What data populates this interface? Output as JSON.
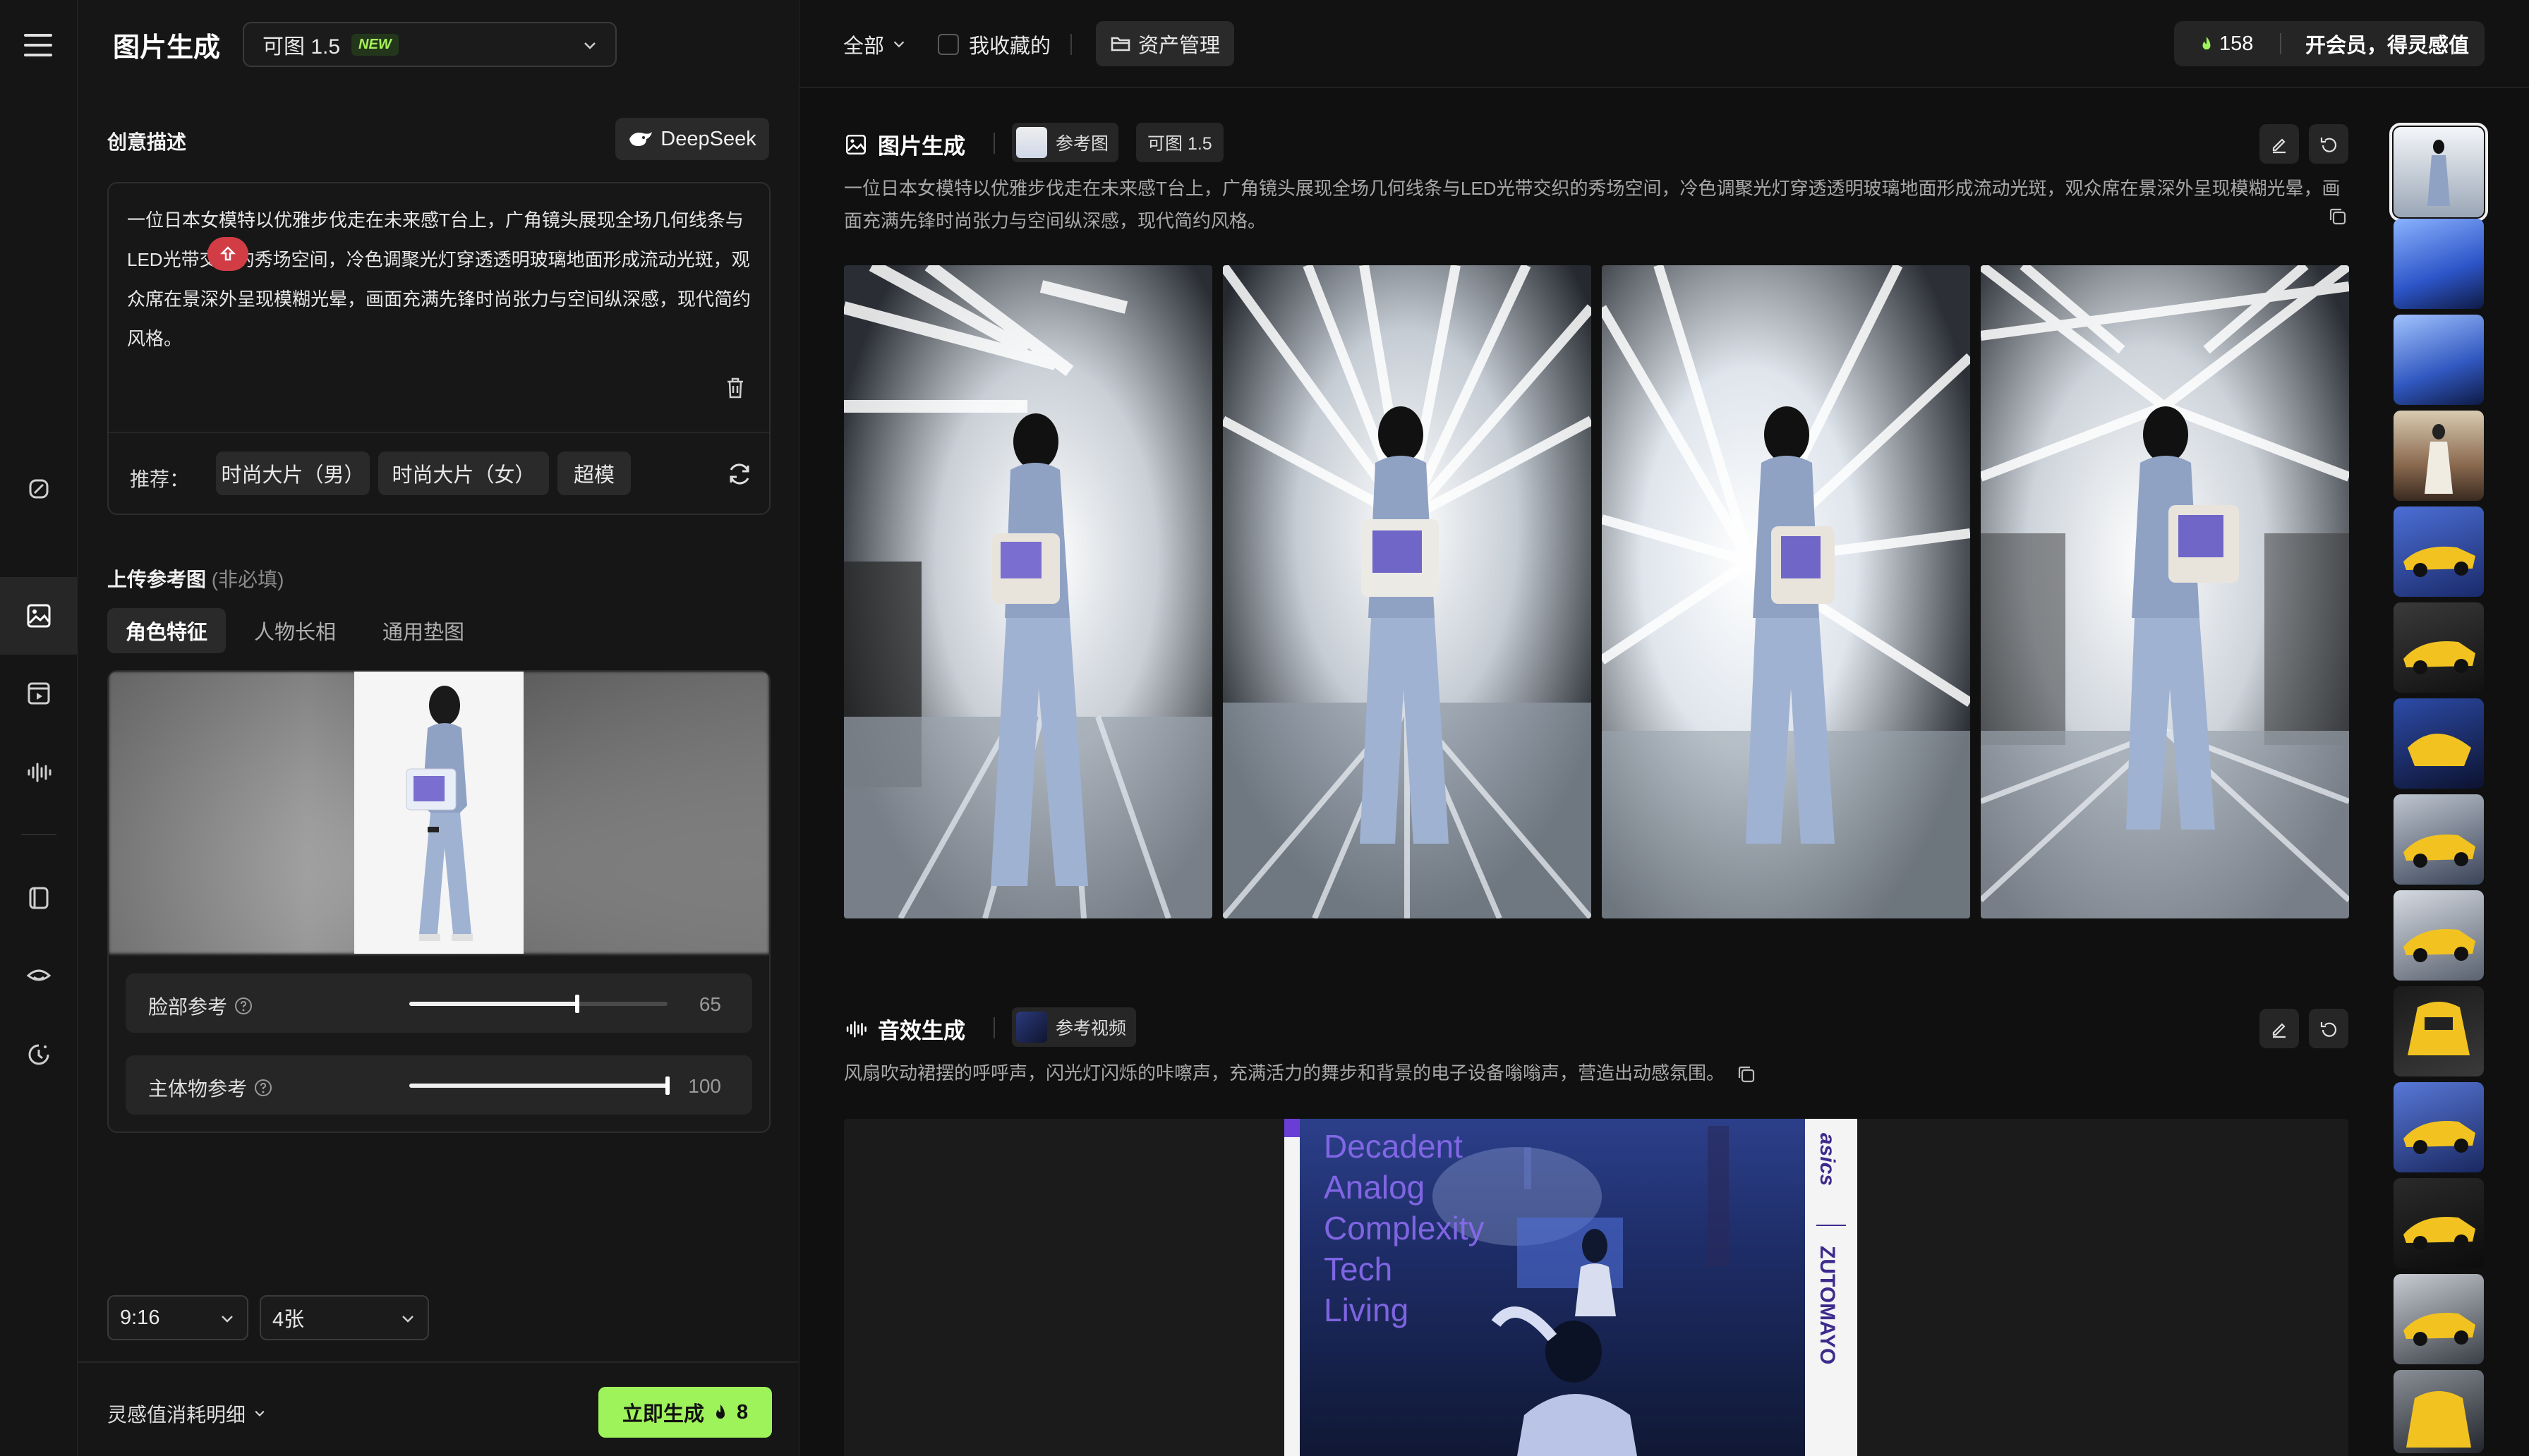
{
  "left_panel": {
    "title": "图片生成",
    "model_selector": {
      "value": "可图 1.5",
      "badge": "NEW"
    },
    "creative_label": "创意描述",
    "deepseek_label": "DeepSeek",
    "prompt": "一位日本女模特以优雅步伐走在未来感T台上，广角镜头展现全场几何线条与LED光带交织的秀场空间，冷色调聚光灯穿透透明玻璃地面形成流动光斑，观众席在景深外呈现模糊光晕，画面充满先锋时尚张力与空间纵深感，现代简约风格。",
    "recommend_label": "推荐：",
    "recommend_chips": [
      "时尚大片（男）",
      "时尚大片（女）",
      "超模"
    ],
    "upload_label": "上传参考图",
    "upload_optional": "(非必填)",
    "tabs": [
      "角色特征",
      "人物长相",
      "通用垫图"
    ],
    "sliders": [
      {
        "label": "脸部参考",
        "value": 65,
        "max": 100
      },
      {
        "label": "主体物参考",
        "value": 100,
        "max": 100
      }
    ],
    "ratio": "9:16",
    "count": "4张",
    "cost_label": "灵感值消耗明细",
    "generate_label": "立即生成",
    "generate_cost": "8"
  },
  "topbar": {
    "filter_all": "全部",
    "favorites": "我收藏的",
    "asset_mgmt": "资产管理",
    "credits": "158",
    "vip": "开会员，得灵感值"
  },
  "image_card": {
    "title": "图片生成",
    "ref_tag": "参考图",
    "model_tag": "可图 1.5",
    "desc": "一位日本女模特以优雅步伐走在未来感T台上，广角镜头展现全场几何线条与LED光带交织的秀场空间，冷色调聚光灯穿透透明玻璃地面形成流动光斑，观众席在景深外呈现模糊光晕，画面充满先锋时尚张力与空间纵深感，现代简约风格。"
  },
  "sound_card": {
    "title": "音效生成",
    "ref_tag": "参考视频",
    "desc": "风扇吹动裙摆的呼呼声，闪光灯闪烁的咔嚓声，充满活力的舞步和背景的电子设备嗡嗡声，营造出动感氛围。"
  },
  "video_overlay": {
    "lines": [
      "Decadent",
      "Analog",
      "Complexity",
      "Tech",
      "Living"
    ],
    "side_top": "asics",
    "side_bottom": "ZUTOMAYO"
  },
  "colors": {
    "accent": "#9ef35a",
    "alert": "#d23c45",
    "bg": "#101010",
    "panel": "#161616"
  },
  "icons": [
    "menu-icon",
    "magic-edit-icon",
    "image-icon",
    "video-icon",
    "audio-wave-icon",
    "box-icon",
    "eye-icon",
    "history-icon",
    "chevron-down-icon",
    "trash-icon",
    "refresh-icon",
    "question-icon",
    "folder-icon",
    "flame-icon",
    "edit-icon",
    "undo-icon",
    "copy-icon",
    "deepseek-whale-icon"
  ]
}
